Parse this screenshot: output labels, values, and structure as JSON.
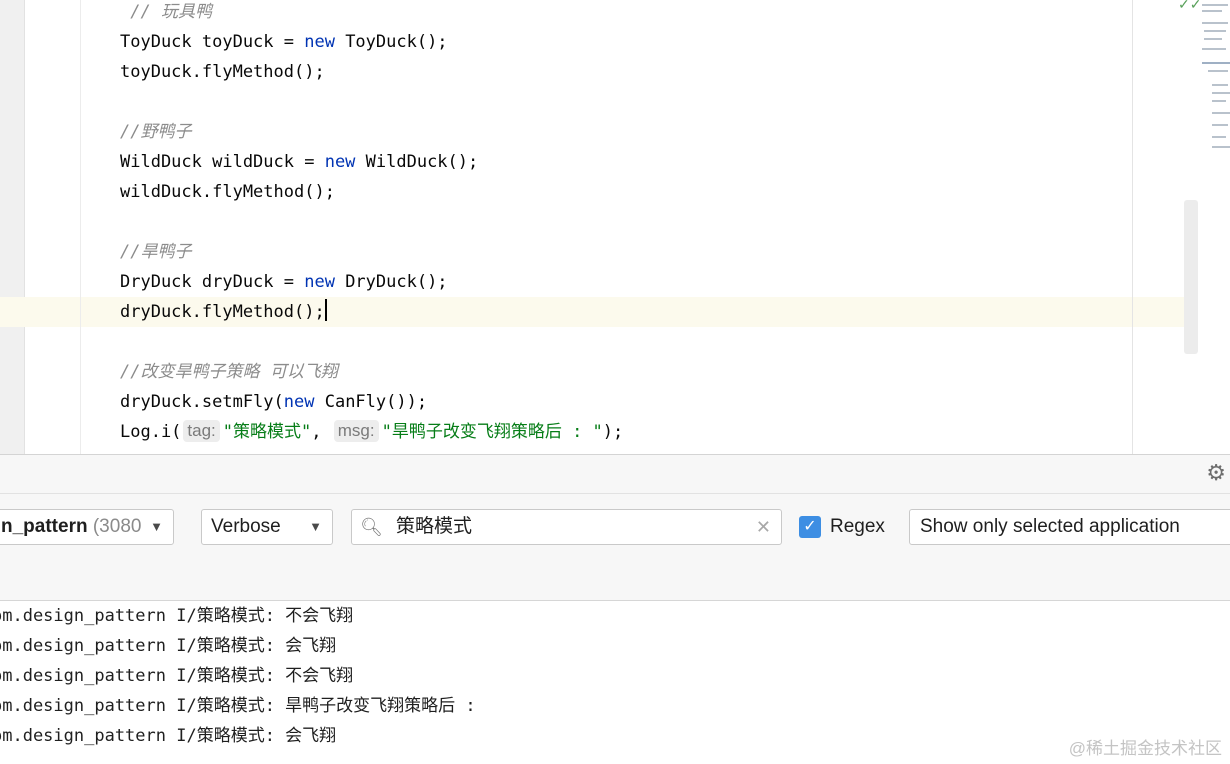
{
  "editor": {
    "lines": [
      {
        "segments": [
          {
            "t": " // 玩具鸭",
            "k": "cm"
          }
        ]
      },
      {
        "segments": [
          {
            "t": "ToyDuck toyDuck = ",
            "k": ""
          },
          {
            "t": "new",
            "k": "kw"
          },
          {
            "t": " ToyDuck();",
            "k": ""
          }
        ]
      },
      {
        "segments": [
          {
            "t": "toyDuck.flyMethod();",
            "k": ""
          }
        ]
      },
      {
        "segments": []
      },
      {
        "segments": [
          {
            "t": "//野鸭子",
            "k": "cm"
          }
        ]
      },
      {
        "segments": [
          {
            "t": "WildDuck wildDuck = ",
            "k": ""
          },
          {
            "t": "new",
            "k": "kw"
          },
          {
            "t": " WildDuck();",
            "k": ""
          }
        ]
      },
      {
        "segments": [
          {
            "t": "wildDuck.flyMethod();",
            "k": ""
          }
        ]
      },
      {
        "segments": []
      },
      {
        "segments": [
          {
            "t": "//旱鸭子",
            "k": "cm"
          }
        ]
      },
      {
        "segments": [
          {
            "t": "DryDuck dryDuck = ",
            "k": ""
          },
          {
            "t": "new",
            "k": "kw"
          },
          {
            "t": " DryDuck();",
            "k": ""
          }
        ]
      },
      {
        "segments": [
          {
            "t": "dryDuck.flyMethod();",
            "k": ""
          }
        ],
        "caret": true
      },
      {
        "segments": []
      },
      {
        "segments": [
          {
            "t": "//改变旱鸭子策略 可以飞翔",
            "k": "cm"
          }
        ]
      },
      {
        "segments": [
          {
            "t": "dryDuck.setmFly(",
            "k": ""
          },
          {
            "t": "new",
            "k": "kw"
          },
          {
            "t": " CanFly());",
            "k": ""
          }
        ]
      },
      {
        "segments": [
          {
            "t": "Log.i(",
            "k": ""
          },
          {
            "t": "tag:",
            "k": "hint"
          },
          {
            "t": "\"策略模式\"",
            "k": "str"
          },
          {
            "t": ", ",
            "k": ""
          },
          {
            "t": "msg:",
            "k": "hint"
          },
          {
            "t": "\"旱鸭子改变飞翔策略后 : \"",
            "k": "str"
          },
          {
            "t": ");",
            "k": ""
          }
        ]
      }
    ]
  },
  "logcat": {
    "process_name": "n_pattern",
    "process_pid": "(3080",
    "level": "Verbose",
    "search_value": "策略模式",
    "regex_label": "Regex",
    "regex_checked": true,
    "app_filter": "Show only selected application",
    "lines": [
      "om.design_pattern I/策略模式: 不会飞翔",
      "om.design_pattern I/策略模式: 会飞翔",
      "om.design_pattern I/策略模式: 不会飞翔",
      "om.design_pattern I/策略模式: 旱鸭子改变飞翔策略后 :",
      "om.design_pattern I/策略模式: 会飞翔"
    ]
  },
  "watermark": "@稀土掘金技术社区",
  "icons": {
    "search": "search-icon",
    "clear": "clear-icon",
    "gear": "gear-icon",
    "dropdown": "chevron-down-icon",
    "check": "checkmark-icon"
  },
  "colors": {
    "keyword": "#0033b3",
    "string": "#067d17",
    "comment": "#8c8c8c",
    "checkbox": "#3d8ee3",
    "current_line": "#fcfaed"
  }
}
